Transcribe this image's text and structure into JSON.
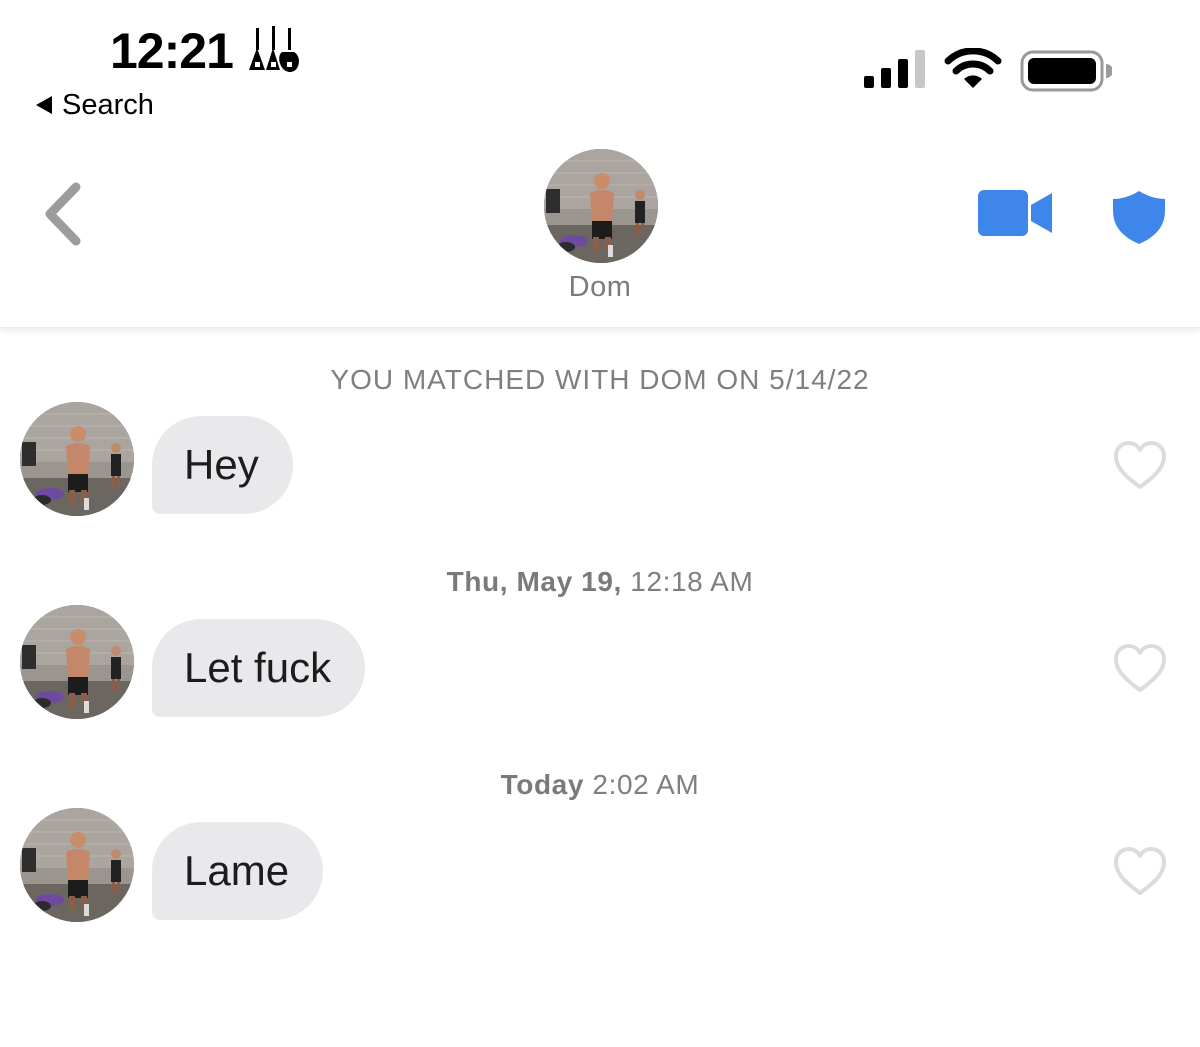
{
  "status_bar": {
    "time": "12:21",
    "back_app_label": "Search",
    "icons": [
      "guitars-icon",
      "cellular-signal-icon",
      "wifi-icon",
      "battery-icon"
    ]
  },
  "header": {
    "match_name": "Dom",
    "icons": [
      "back-chevron-icon",
      "video-call-icon",
      "safety-shield-icon"
    ],
    "accent_color": "#3f86ea"
  },
  "conversation": {
    "match_note": "YOU MATCHED WITH DOM ON 5/14/22",
    "groups": [
      {
        "day": "",
        "time": "",
        "message": "Hey"
      },
      {
        "day": "Thu, May 19,",
        "time": "12:18 AM",
        "message": "Let fuck"
      },
      {
        "day": "Today",
        "time": "2:02 AM",
        "message": "Lame"
      }
    ],
    "bubble_color": "#e9e9eb",
    "like_icon": "heart-outline-icon"
  }
}
